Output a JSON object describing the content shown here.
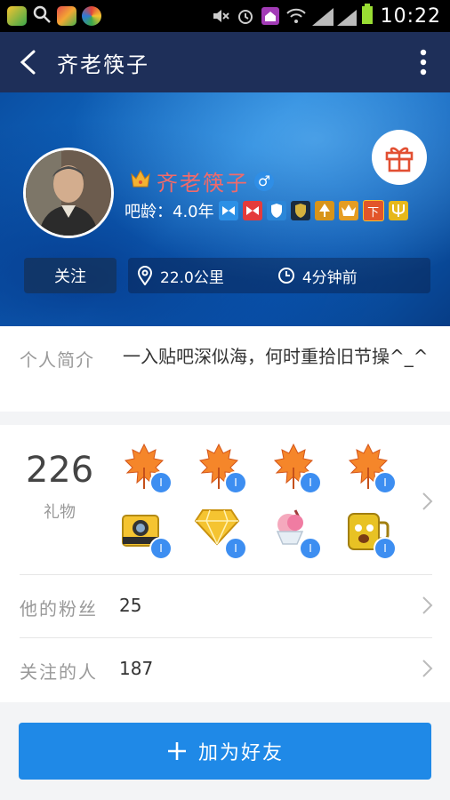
{
  "status_bar": {
    "time": "10:22",
    "icons": [
      "app-icon-1",
      "search-icon",
      "app-icon-2",
      "app-icon-3",
      "mute-icon",
      "alarm-icon",
      "home-icon",
      "wifi-icon",
      "signal-icon",
      "signal-icon",
      "battery-icon"
    ]
  },
  "header": {
    "title": "齐老筷子"
  },
  "profile": {
    "name": "齐老筷子",
    "gender_symbol": "♂",
    "age_text": "吧龄：4.0年",
    "follow_label": "关注",
    "distance": "22.0公里",
    "last_active": "4分钟前",
    "badges": [
      "ribbon-blue",
      "ribbon-red",
      "shield-blue",
      "shield-dark",
      "tree-gold",
      "crown-gold",
      "下",
      "trident-gold"
    ]
  },
  "intro": {
    "label": "个人简介",
    "text": "一入贴吧深似海，何时重拾旧节操^_^"
  },
  "gifts": {
    "count": "226",
    "label": "礼物",
    "items": [
      {
        "name": "maple-leaf",
        "badge": "I"
      },
      {
        "name": "maple-leaf",
        "badge": "I"
      },
      {
        "name": "maple-leaf",
        "badge": "I"
      },
      {
        "name": "maple-leaf",
        "badge": "I"
      },
      {
        "name": "camera",
        "badge": "I"
      },
      {
        "name": "diamond",
        "badge": "I"
      },
      {
        "name": "ice-cream",
        "badge": "I"
      },
      {
        "name": "cup",
        "badge": "I"
      }
    ]
  },
  "fans": {
    "label": "他的粉丝",
    "value": "25"
  },
  "following": {
    "label": "关注的人",
    "value": "187"
  },
  "action": {
    "add_friend_label": "加为好友"
  },
  "colors": {
    "accent": "#1f89e7",
    "title_bar": "#1e2f59",
    "name": "#f16a6a"
  }
}
